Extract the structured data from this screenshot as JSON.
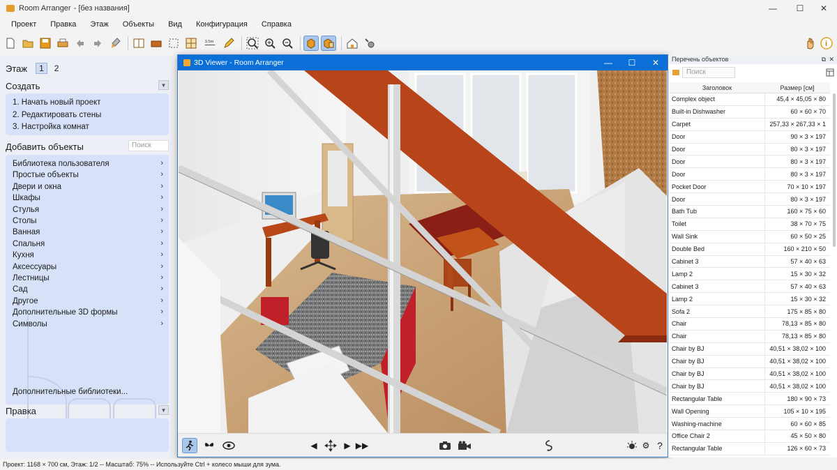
{
  "window": {
    "title": "Room Arranger",
    "subtitle": "[без названия]"
  },
  "menu": [
    "Проект",
    "Правка",
    "Этаж",
    "Объекты",
    "Вид",
    "Конфигурация",
    "Справка"
  ],
  "left": {
    "floor_label": "Этаж",
    "floors": [
      "1",
      "2"
    ],
    "create_header": "Создать",
    "create_items": [
      "1. Начать новый проект",
      "2. Редактировать стены",
      "3. Настройка комнат"
    ],
    "add_header": "Добавить объекты",
    "search_placeholder": "Поиск",
    "categories": [
      "Библиотека пользователя",
      "Простые объекты",
      "Двери и окна",
      "Шкафы",
      "Стулья",
      "Столы",
      "Ванная",
      "Спальня",
      "Кухня",
      "Аксессуары",
      "Лестницы",
      "Сад",
      "Другое",
      "Дополнительные 3D формы",
      "Символы"
    ],
    "more_libraries": "Дополнительные библиотеки...",
    "edit_header": "Правка"
  },
  "viewer": {
    "title": "3D Viewer - Room Arranger"
  },
  "objects": {
    "title": "Перечень объектов",
    "search_placeholder": "Поиск",
    "col_name": "Заголовок",
    "col_size": "Размер [см]",
    "rows": [
      {
        "name": "Complex object",
        "size": "45,4 × 45,05 × 80"
      },
      {
        "name": "Built-in Dishwasher",
        "size": "60 × 60 × 70"
      },
      {
        "name": "Carpet",
        "size": "257,33 × 267,33 × 1"
      },
      {
        "name": "Door",
        "size": "90 × 3 × 197"
      },
      {
        "name": "Door",
        "size": "80 × 3 × 197"
      },
      {
        "name": "Door",
        "size": "80 × 3 × 197"
      },
      {
        "name": "Door",
        "size": "80 × 3 × 197"
      },
      {
        "name": "Pocket Door",
        "size": "70 × 10 × 197"
      },
      {
        "name": "Door",
        "size": "80 × 3 × 197"
      },
      {
        "name": "Bath Tub",
        "size": "160 × 75 × 60"
      },
      {
        "name": "Toilet",
        "size": "38 × 70 × 75"
      },
      {
        "name": "Wall Sink",
        "size": "60 × 50 × 25"
      },
      {
        "name": "Double Bed",
        "size": "160 × 210 × 50"
      },
      {
        "name": "Cabinet 3",
        "size": "57 × 40 × 63"
      },
      {
        "name": "Lamp 2",
        "size": "15 × 30 × 32"
      },
      {
        "name": "Cabinet 3",
        "size": "57 × 40 × 63"
      },
      {
        "name": "Lamp 2",
        "size": "15 × 30 × 32"
      },
      {
        "name": "Sofa 2",
        "size": "175 × 85 × 80"
      },
      {
        "name": "Chair",
        "size": "78,13 × 85 × 80"
      },
      {
        "name": "Chair",
        "size": "78,13 × 85 × 80"
      },
      {
        "name": "Chair by BJ",
        "size": "40,51 × 38,02 × 100"
      },
      {
        "name": "Chair by BJ",
        "size": "40,51 × 38,02 × 100"
      },
      {
        "name": "Chair by BJ",
        "size": "40,51 × 38,02 × 100"
      },
      {
        "name": "Chair by BJ",
        "size": "40,51 × 38,02 × 100"
      },
      {
        "name": "Rectangular Table",
        "size": "180 × 90 × 73"
      },
      {
        "name": "Wall Opening",
        "size": "105 × 10 × 195"
      },
      {
        "name": "Washing-machine",
        "size": "60 × 60 × 85"
      },
      {
        "name": "Office Chair 2",
        "size": "45 × 50 × 80"
      },
      {
        "name": "Rectangular Table",
        "size": "126 × 60 × 73"
      }
    ]
  },
  "status": "Проект: 1168 × 700 см, Этаж: 1/2 -- Масштаб: 75% -- Используйте Ctrl + колесо мыши для зума."
}
